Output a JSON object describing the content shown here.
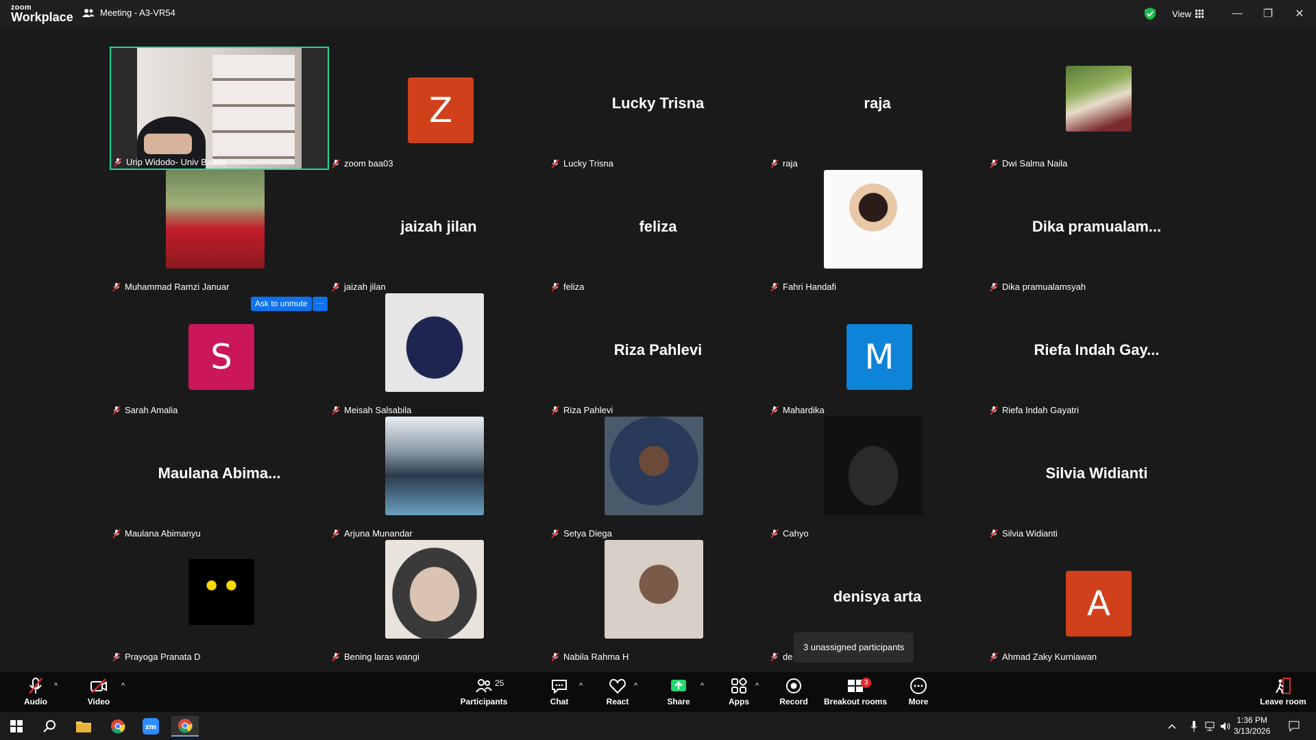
{
  "titlebar": {
    "logo_small": "zoom",
    "logo_big": "Workplace",
    "meeting_title": "Meeting - A3-VR54",
    "view_label": "View",
    "colors": {
      "shield": "#1fb84f"
    }
  },
  "participants": [
    {
      "name": "Urip Widodo- Univ Bakrie",
      "display": "video"
    },
    {
      "name": "zoom baa03",
      "display": "letter",
      "letter": "Z",
      "color": "#d0401a"
    },
    {
      "name": "Lucky Trisna",
      "display": "text",
      "text": "Lucky Trisna"
    },
    {
      "name": "raja",
      "display": "text",
      "text": "raja"
    },
    {
      "name": "Dwi Salma Naila",
      "display": "photo"
    },
    {
      "name": "Muhammad Ramzi Januar",
      "display": "photo"
    },
    {
      "name": "jaizah jilan",
      "display": "text",
      "text": "jaizah jilan"
    },
    {
      "name": "feliza",
      "display": "text",
      "text": "feliza"
    },
    {
      "name": "Fahri Handafi",
      "display": "photo"
    },
    {
      "name": "Dika pramualamsyah",
      "display": "text",
      "text": "Dika  pramualam..."
    },
    {
      "name": "Sarah Amalia",
      "display": "letter",
      "letter": "S",
      "color": "#c9175a"
    },
    {
      "name": "Meisah Salsabila",
      "display": "photo"
    },
    {
      "name": "Riza Pahlevi",
      "display": "text",
      "text": "Riza Pahlevi"
    },
    {
      "name": "Mahardika",
      "display": "letter",
      "letter": "M",
      "color": "#0e84d8"
    },
    {
      "name": "Riefa Indah Gayatri",
      "display": "text",
      "text": "Riefa  Indah  Gay..."
    },
    {
      "name": "Maulana Abimanyu",
      "display": "text",
      "text": "Maulana  Abima..."
    },
    {
      "name": "Arjuna Munandar",
      "display": "photo"
    },
    {
      "name": "Setya Diega",
      "display": "photo"
    },
    {
      "name": "Cahyo",
      "display": "photo"
    },
    {
      "name": "Silvia Widianti",
      "display": "text",
      "text": "Silvia Widianti"
    },
    {
      "name": "Prayoga Pranata D",
      "display": "photo"
    },
    {
      "name": "Bening laras wangi",
      "display": "photo"
    },
    {
      "name": "Nabila Rahma H",
      "display": "photo"
    },
    {
      "name": "de",
      "display": "text",
      "text": "denisya arta"
    },
    {
      "name": "Ahmad Zaky Kurniawan",
      "display": "letter",
      "letter": "A",
      "color": "#d0401a"
    }
  ],
  "ask_unmute": {
    "label": "Ask to unmute",
    "more": "···"
  },
  "tooltip": "3 unassigned participants",
  "toolbar": {
    "audio": "Audio",
    "video": "Video",
    "participants": "Participants",
    "participants_count": "25",
    "chat": "Chat",
    "react": "React",
    "share": "Share",
    "apps": "Apps",
    "record": "Record",
    "breakout": "Breakout rooms",
    "breakout_badge": "3",
    "more": "More",
    "leave": "Leave room"
  },
  "taskbar": {
    "time": "1:36 PM",
    "date": "3/13/2026"
  }
}
